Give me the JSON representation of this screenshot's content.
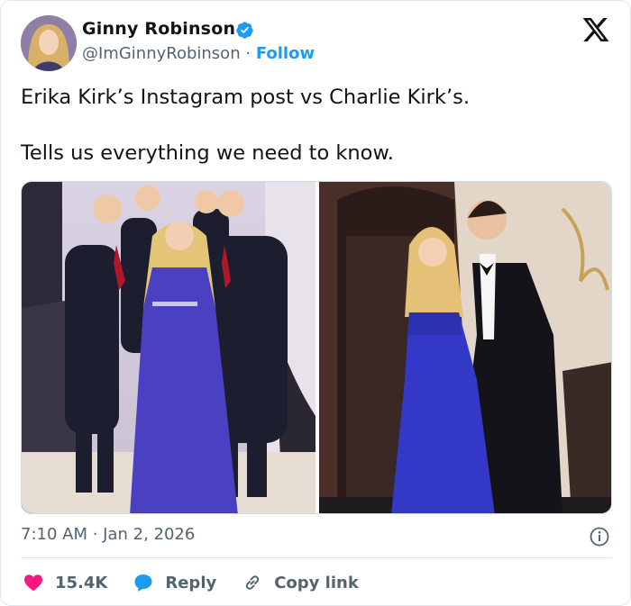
{
  "user": {
    "display_name": "Ginny Robinson",
    "handle": "@ImGinnyRobinson",
    "separator": "·",
    "follow_label": "Follow"
  },
  "tweet": {
    "text": "Erika Kirk’s Instagram post vs Charlie Kirk’s.\n\nTells us everything we need to know.",
    "timestamp": "7:10 AM · Jan 2, 2026"
  },
  "actions": {
    "likes": "15.4K",
    "reply_label": "Reply",
    "copy_link_label": "Copy link"
  },
  "colors": {
    "accent": "#1d9bf0",
    "like": "#f91880",
    "text": "#0f1419",
    "muted": "#536471"
  },
  "icons": [
    "verified-badge-icon",
    "x-logo-icon",
    "info-icon",
    "heart-icon",
    "reply-bubble-icon",
    "link-icon"
  ]
}
